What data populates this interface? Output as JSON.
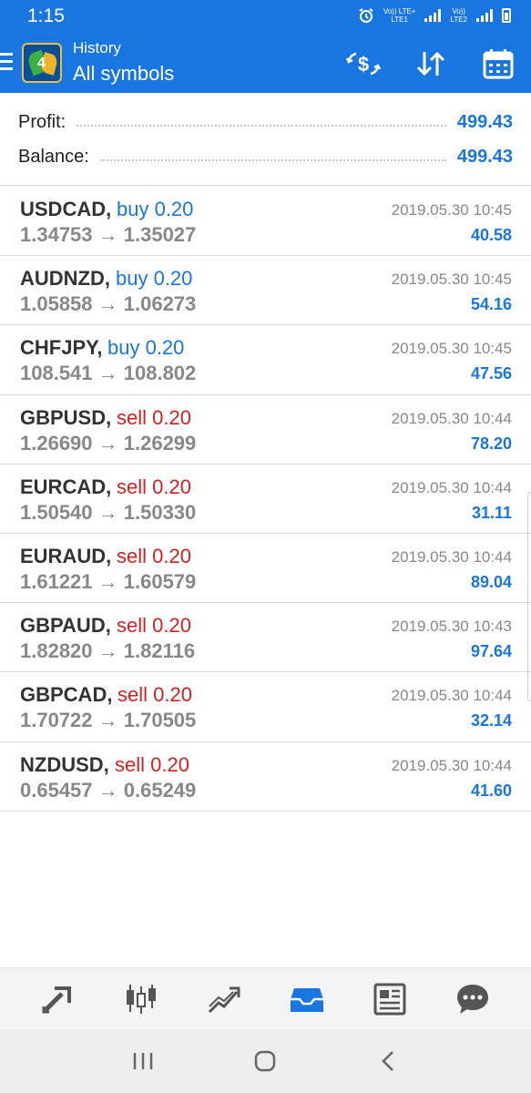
{
  "status_bar": {
    "time": "1:15",
    "sim1_label": "Vo)) LTE+\nLTE1",
    "sim2_label": "Vo))\nLTE2"
  },
  "header": {
    "subtitle": "History",
    "title": "All symbols"
  },
  "summary": {
    "profit_label": "Profit:",
    "profit_value": "499.43",
    "balance_label": "Balance:",
    "balance_value": "499.43"
  },
  "trades": [
    {
      "symbol": "USDCAD,",
      "side": "buy 0.20",
      "type": "buy",
      "prices": "1.34753 → 1.35027",
      "time": "2019.05.30 10:45",
      "profit": "40.58"
    },
    {
      "symbol": "AUDNZD,",
      "side": "buy 0.20",
      "type": "buy",
      "prices": "1.05858 → 1.06273",
      "time": "2019.05.30 10:45",
      "profit": "54.16"
    },
    {
      "symbol": "CHFJPY,",
      "side": "buy 0.20",
      "type": "buy",
      "prices": "108.541 → 108.802",
      "time": "2019.05.30 10:45",
      "profit": "47.56"
    },
    {
      "symbol": "GBPUSD,",
      "side": "sell 0.20",
      "type": "sell",
      "prices": "1.26690 → 1.26299",
      "time": "2019.05.30 10:44",
      "profit": "78.20"
    },
    {
      "symbol": "EURCAD,",
      "side": "sell 0.20",
      "type": "sell",
      "prices": "1.50540 → 1.50330",
      "time": "2019.05.30 10:44",
      "profit": "31.11"
    },
    {
      "symbol": "EURAUD,",
      "side": "sell 0.20",
      "type": "sell",
      "prices": "1.61221 → 1.60579",
      "time": "2019.05.30 10:44",
      "profit": "89.04"
    },
    {
      "symbol": "GBPAUD,",
      "side": "sell 0.20",
      "type": "sell",
      "prices": "1.82820 → 1.82116",
      "time": "2019.05.30 10:43",
      "profit": "97.64"
    },
    {
      "symbol": "GBPCAD,",
      "side": "sell 0.20",
      "type": "sell",
      "prices": "1.70722 → 1.70505",
      "time": "2019.05.30 10:44",
      "profit": "32.14"
    },
    {
      "symbol": "NZDUSD,",
      "side": "sell 0.20",
      "type": "sell",
      "prices": "0.65457 → 0.65249",
      "time": "2019.05.30 10:44",
      "profit": "41.60"
    }
  ],
  "colors": {
    "primary": "#1976e1",
    "buy": "#1976e1",
    "sell": "#d32121",
    "muted": "#888888"
  },
  "icons": {
    "header_actions": [
      "currency-exchange-icon",
      "sort-icon",
      "calendar-icon"
    ],
    "bottom_nav": [
      "quotes-icon",
      "chart-icon",
      "trade-icon",
      "history-icon",
      "news-icon",
      "chat-icon"
    ],
    "bottom_nav_active": "history-icon",
    "system_nav": [
      "recent-apps-icon",
      "home-icon",
      "back-icon"
    ]
  }
}
